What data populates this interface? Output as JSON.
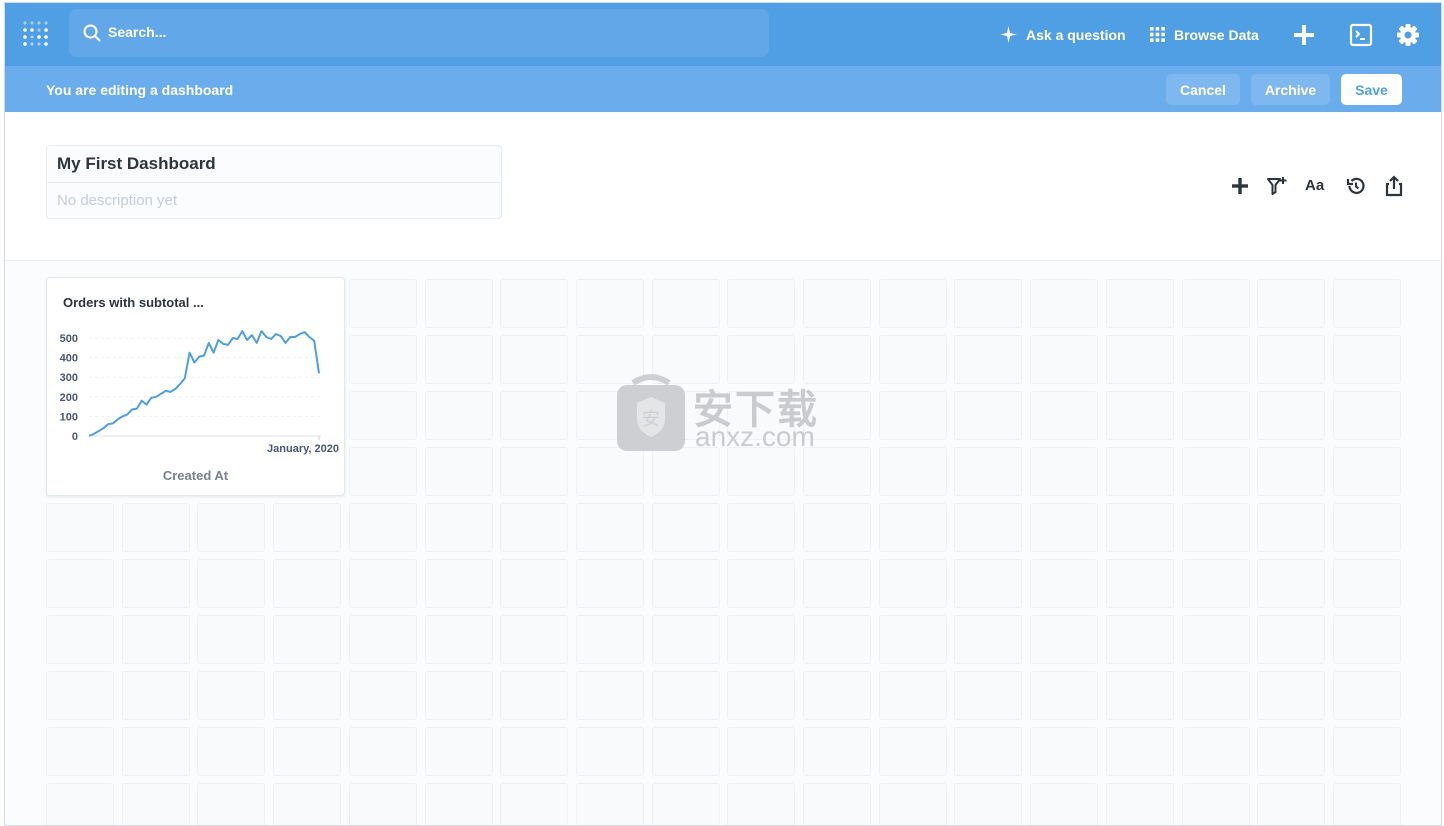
{
  "topnav": {
    "search_placeholder": "Search...",
    "ask_label": "Ask a question",
    "browse_label": "Browse Data",
    "colors": {
      "nav_bg": "#509ee3",
      "search_bg": "#62a8e8"
    }
  },
  "editbar": {
    "message": "You are editing a dashboard",
    "cancel_label": "Cancel",
    "archive_label": "Archive",
    "save_label": "Save"
  },
  "dashboard": {
    "title": "My First Dashboard",
    "description_placeholder": "No description yet",
    "text_icon_label": "Aa"
  },
  "card": {
    "title": "Orders with subtotal ...",
    "x_axis_label": "Created At",
    "x_tick_label": "January, 2020",
    "y_ticks": [
      "500",
      "400",
      "300",
      "200",
      "100",
      "0"
    ]
  },
  "chart_data": {
    "type": "line",
    "title": "Orders with subtotal ...",
    "xlabel": "Created At",
    "ylabel": "",
    "ylim": [
      0,
      500
    ],
    "x_tick_labels": [
      "January, 2020"
    ],
    "y_tick_labels": [
      0,
      100,
      200,
      300,
      400,
      500
    ],
    "color": "#509ee3",
    "series": [
      {
        "values": [
          0,
          10,
          25,
          40,
          60,
          65,
          85,
          100,
          110,
          135,
          140,
          180,
          160,
          195,
          200,
          215,
          230,
          225,
          240,
          265,
          295,
          425,
          375,
          405,
          410,
          475,
          425,
          490,
          470,
          465,
          500,
          495,
          535,
          490,
          515,
          475,
          535,
          505,
          495,
          520,
          510,
          475,
          505,
          505,
          520,
          530,
          505,
          485,
          320
        ]
      }
    ]
  },
  "watermark": {
    "cn": "安下载",
    "en": "anxz.com"
  }
}
